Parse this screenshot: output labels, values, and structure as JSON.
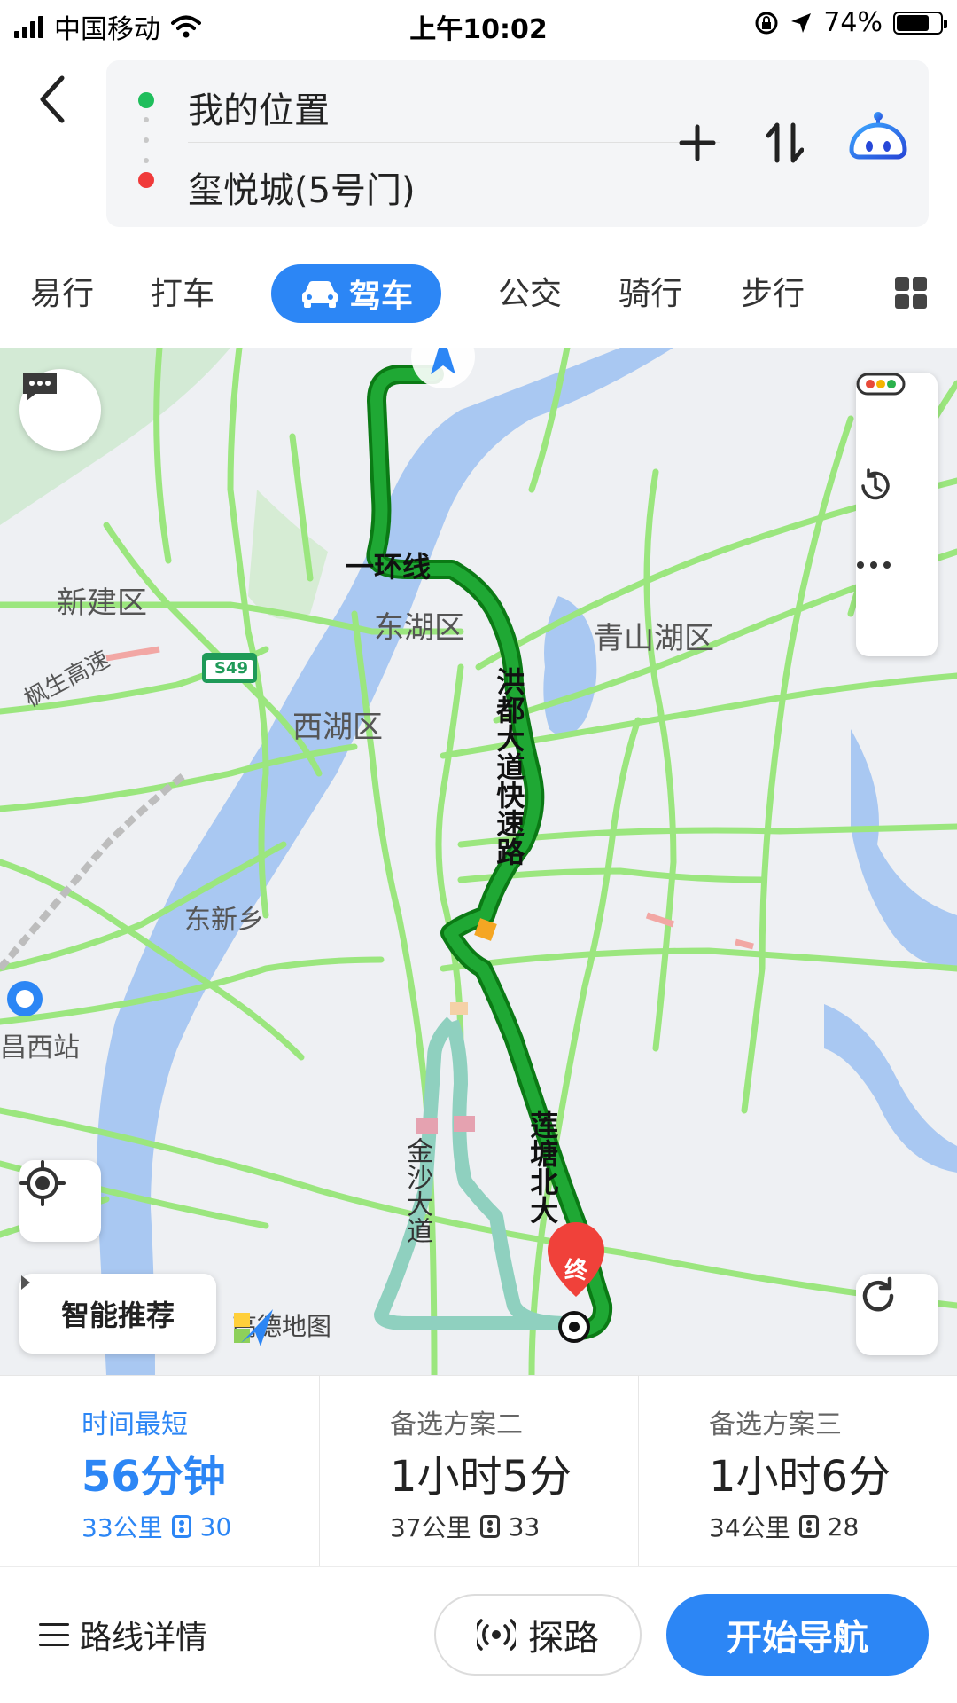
{
  "status_bar": {
    "carrier": "中国移动",
    "time": "上午10:02",
    "battery_pct": "74%",
    "battery_level": 0.74
  },
  "header": {
    "start": "我的位置",
    "destination": "玺悦城(5号门)"
  },
  "modes": {
    "items": [
      "易行",
      "打车",
      "驾车",
      "公交",
      "骑行",
      "步行"
    ],
    "active": "驾车"
  },
  "map": {
    "labels": {
      "xinjian": "新建区",
      "donghu": "东湖区",
      "qingshanhu": "青山湖区",
      "xihu": "西湖区",
      "dongxin": "东新乡",
      "station": "昌西站",
      "highway": "枫生高速",
      "s49": "S49"
    },
    "roads": {
      "ring": "一环线",
      "hongdu": "洪都大道快速路",
      "liantang": "莲塘北大",
      "jinsha": "金沙大道"
    },
    "end_marker": "终",
    "smart_recommend": "智能推荐",
    "logo_text": "高德地图"
  },
  "routes": [
    {
      "title": "时间最短",
      "time": "56分钟",
      "distance": "33公里",
      "lights": "30"
    },
    {
      "title": "备选方案二",
      "time": "1小时5分",
      "distance": "37公里",
      "lights": "33"
    },
    {
      "title": "备选方案三",
      "time": "1小时6分",
      "distance": "34公里",
      "lights": "28"
    }
  ],
  "bottom": {
    "details": "路线详情",
    "explore": "探路",
    "start_nav": "开始导航"
  },
  "colors": {
    "accent": "#2c86f5",
    "route_green": "#1fa834",
    "alt_route": "#8fd0bf",
    "water": "#a9c8f2",
    "road": "#9be67e"
  }
}
